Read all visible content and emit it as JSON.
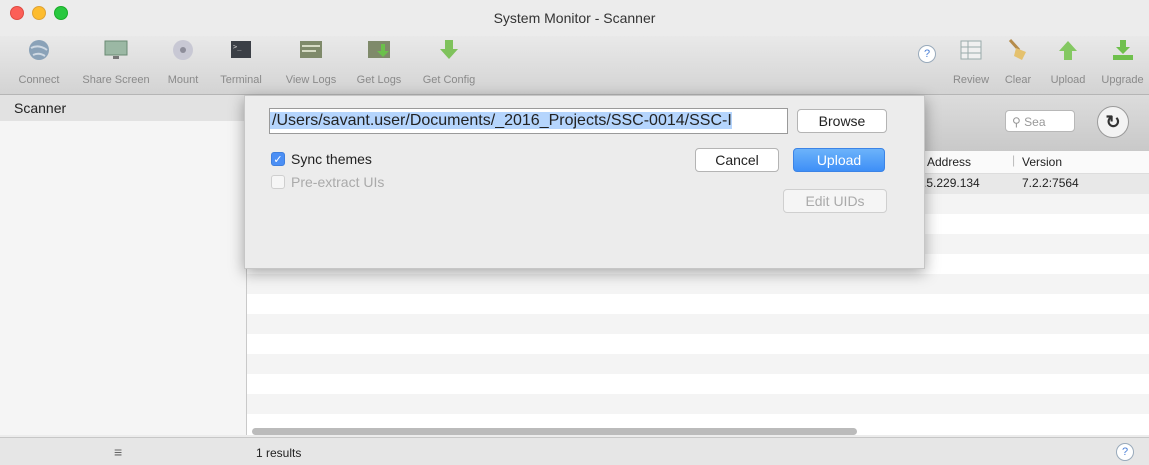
{
  "window": {
    "title": "System Monitor - Scanner",
    "colors": {
      "close": "#fc5f57",
      "minimize": "#fdbc2e",
      "zoom": "#28c83f"
    }
  },
  "toolbar": {
    "left": [
      {
        "label": "Connect",
        "icon": "globe-icon"
      },
      {
        "label": "Share Screen",
        "icon": "screen-icon"
      },
      {
        "label": "Mount",
        "icon": "disk-icon"
      },
      {
        "label": "Terminal",
        "icon": "terminal-icon"
      },
      {
        "label": "View Logs",
        "icon": "log-icon"
      },
      {
        "label": "Get Logs",
        "icon": "log-download-icon"
      },
      {
        "label": "Get Config",
        "icon": "download-arrow-icon"
      }
    ],
    "right": [
      {
        "label": "Review",
        "icon": "table-icon"
      },
      {
        "label": "Clear",
        "icon": "broom-icon"
      },
      {
        "label": "Upload",
        "icon": "upload-arrow-icon"
      },
      {
        "label": "Upgrade",
        "icon": "upgrade-icon"
      }
    ],
    "help": "?"
  },
  "sidebar": {
    "items": [
      {
        "label": "Scanner"
      }
    ]
  },
  "main": {
    "search_placeholder": "Sea",
    "columns": [
      "Address",
      "Version"
    ],
    "rows": [
      {
        "address": ".5.229.134",
        "version": "7.2.2:7564"
      }
    ]
  },
  "status": {
    "text": "1 results",
    "help": "?"
  },
  "dialog": {
    "path": "/Users/savant.user/Documents/_2016_Projects/SSC-0014/SSC-I",
    "browse": "Browse",
    "cancel": "Cancel",
    "upload": "Upload",
    "edit_uids": "Edit UIDs",
    "sync_themes": {
      "label": "Sync themes",
      "checked": true
    },
    "pre_extract": {
      "label": "Pre-extract UIs",
      "checked": false,
      "enabled": false
    }
  }
}
